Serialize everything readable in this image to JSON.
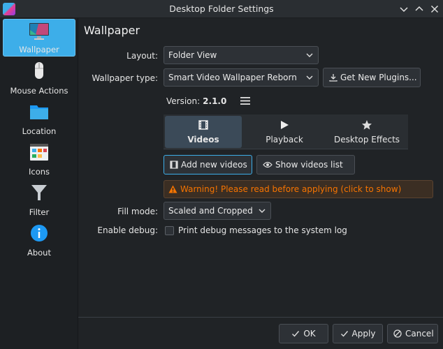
{
  "window": {
    "title": "Desktop Folder Settings",
    "controls": [
      "chevron-down-icon",
      "chevron-up-icon",
      "close-icon"
    ]
  },
  "sidebar": {
    "items": [
      {
        "label": "Wallpaper",
        "icon": "monitor-icon",
        "active": true
      },
      {
        "label": "Mouse Actions",
        "icon": "mouse-icon",
        "active": false
      },
      {
        "label": "Location",
        "icon": "folder-icon",
        "active": false
      },
      {
        "label": "Icons",
        "icon": "icons-view-icon",
        "active": false
      },
      {
        "label": "Filter",
        "icon": "funnel-icon",
        "active": false
      },
      {
        "label": "About",
        "icon": "info-icon",
        "active": false
      }
    ]
  },
  "main": {
    "title": "Wallpaper",
    "layout": {
      "label": "Layout:",
      "value": "Folder View"
    },
    "wallpaper_type": {
      "label": "Wallpaper type:",
      "value": "Smart Video Wallpaper Reborn"
    },
    "get_plugins_label": "Get New Plugins...",
    "version": {
      "label": "Version:",
      "value": "2.1.0"
    },
    "tabs": [
      {
        "label": "Videos",
        "icon": "film-icon",
        "active": true
      },
      {
        "label": "Playback",
        "icon": "play-icon",
        "active": false
      },
      {
        "label": "Desktop Effects",
        "icon": "star-icon",
        "active": false
      }
    ],
    "add_videos_label": "Add new videos",
    "show_list_label": "Show videos list",
    "warning_text": "Warning! Please read before applying (click to show)",
    "fill_mode": {
      "label": "Fill mode:",
      "value": "Scaled and Cropped"
    },
    "debug": {
      "label": "Enable debug:",
      "checkbox_text": "Print debug messages to the system log",
      "checked": false
    }
  },
  "footer": {
    "ok_label": "OK",
    "apply_label": "Apply",
    "cancel_label": "Cancel"
  },
  "colors": {
    "accent": "#3daee9",
    "warning": "#f67400",
    "background": "#202326",
    "sidebar": "#1d2023"
  }
}
